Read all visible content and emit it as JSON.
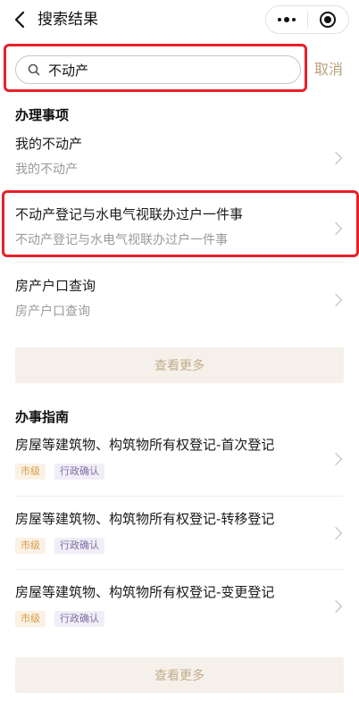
{
  "navbar": {
    "title": "搜索结果"
  },
  "search": {
    "value": "不动产",
    "cancel_label": "取消"
  },
  "sections": {
    "services_title": "办理事项",
    "guides_title": "办事指南"
  },
  "services": [
    {
      "title": "我的不动产",
      "subtitle": "我的不动产"
    },
    {
      "title": "不动产登记与水电气视联办过户一件事",
      "subtitle": "不动产登记与水电气视联办过户一件事"
    },
    {
      "title": "房产户口查询",
      "subtitle": "房产户口查询"
    }
  ],
  "services_more_label": "查看更多",
  "guides": [
    {
      "title": "房屋等建筑物、构筑物所有权登记-首次登记",
      "tag_level": "市级",
      "tag_type": "行政确认"
    },
    {
      "title": "房屋等建筑物、构筑物所有权登记-转移登记",
      "tag_level": "市级",
      "tag_type": "行政确认"
    },
    {
      "title": "房屋等建筑物、构筑物所有权登记-变更登记",
      "tag_level": "市级",
      "tag_type": "行政确认"
    }
  ],
  "guides_more_label": "查看更多",
  "colors": {
    "accent": "#b9a27d",
    "highlight_border": "#e8202a",
    "more_bg": "#f5f1ea",
    "tag_city": "#d79a4a",
    "tag_admin": "#7d6fa6"
  }
}
